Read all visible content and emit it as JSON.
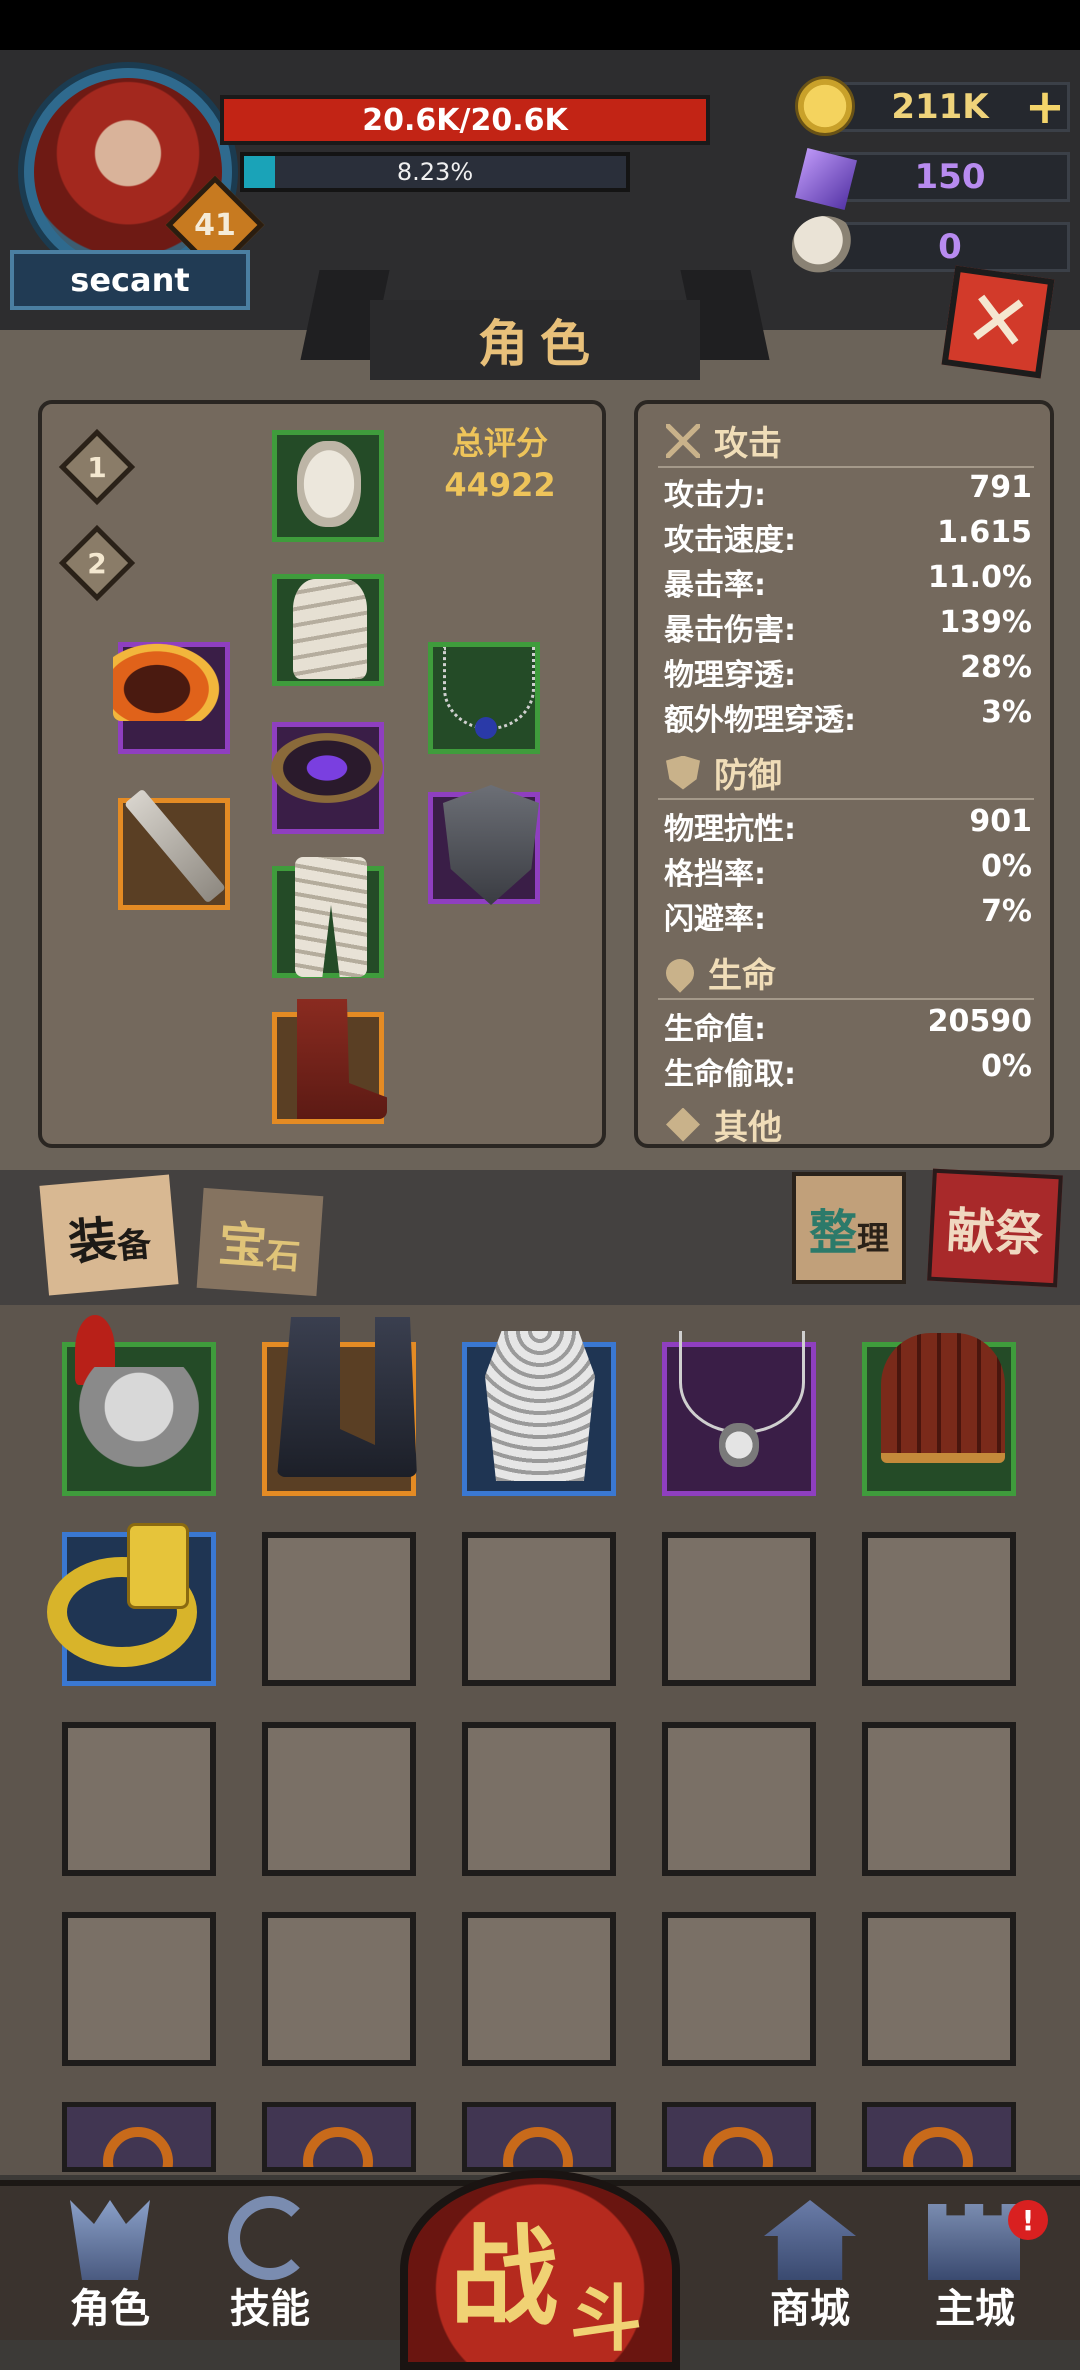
{
  "player": {
    "name": "secant",
    "level": "41",
    "hp_text": "20.6K/20.6K",
    "xp_text": "8.23%",
    "xp_fraction": 0.0823
  },
  "currency": {
    "gold": "211K",
    "crystal": "150",
    "ram_horn": "0",
    "add_label": "+"
  },
  "panel": {
    "title": "角色",
    "close_label": "✕",
    "loadouts": [
      "1",
      "2"
    ],
    "score_label": "总评分",
    "score_value": "44922"
  },
  "stats": {
    "attack_title": "攻击",
    "defense_title": "防御",
    "life_title": "生命",
    "other_title": "其他",
    "attack": [
      {
        "label": "攻击力:",
        "value": "791"
      },
      {
        "label": "攻击速度:",
        "value": "1.615"
      },
      {
        "label": "暴击率:",
        "value": "11.0%"
      },
      {
        "label": "暴击伤害:",
        "value": "139%"
      },
      {
        "label": "物理穿透:",
        "value": "28%"
      },
      {
        "label": "额外物理穿透:",
        "value": "3%"
      }
    ],
    "defense": [
      {
        "label": "物理抗性:",
        "value": "901"
      },
      {
        "label": "格挡率:",
        "value": "0%"
      },
      {
        "label": "闪避率:",
        "value": "7%"
      }
    ],
    "life": [
      {
        "label": "生命值:",
        "value": "20590"
      },
      {
        "label": "生命偷取:",
        "value": "0%"
      }
    ]
  },
  "tabs": {
    "equip_main": "装",
    "equip_sub": "备",
    "gem_main": "宝",
    "gem_sub": "石",
    "tidy_main": "整",
    "tidy_sub": "理",
    "sacrifice": "献祭"
  },
  "bottom_nav": {
    "character": "角色",
    "skills": "技能",
    "battle_main": "战",
    "battle_sub": "斗",
    "shop": "商城",
    "main_city": "主城",
    "alert": "!"
  },
  "colors": {
    "hp": "#c22415",
    "xp": "#1aa3b8",
    "gold_text": "#efd37a",
    "crystal_text": "#b88bf0",
    "score": "#eec45a",
    "quality_green": "#3f9c3c",
    "quality_purple": "#8f3fc0",
    "quality_orange": "#e48b24",
    "quality_blue": "#3a78d2"
  }
}
